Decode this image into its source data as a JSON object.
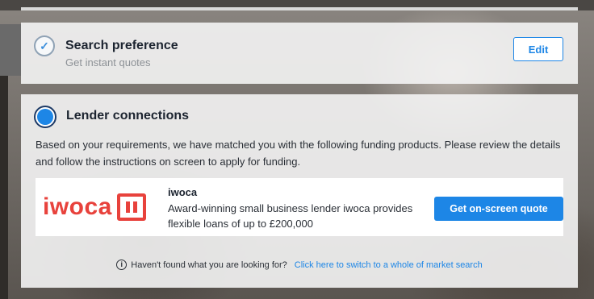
{
  "search_preference": {
    "title": "Search preference",
    "subtitle": "Get instant quotes",
    "edit_label": "Edit",
    "status_icon": "check-icon"
  },
  "lender_connections": {
    "title": "Lender connections",
    "description": "Based on your requirements, we have matched you with the following funding products. Please review the details and follow the instructions on screen to apply for funding.",
    "product": {
      "logo_text": "iwoca",
      "name": "iwoca",
      "description": "Award-winning small business lender iwoca provides flexible loans of up to £200,000",
      "cta_label": "Get on-screen quote"
    },
    "footer": {
      "info_icon": "info-icon",
      "question": "Haven't found what you are looking for?",
      "link_label": "Click here to switch to a whole of market search"
    }
  },
  "colors": {
    "accent": "#1d86e6",
    "brand_iwoca": "#e8423c",
    "text": "#1c2430"
  }
}
